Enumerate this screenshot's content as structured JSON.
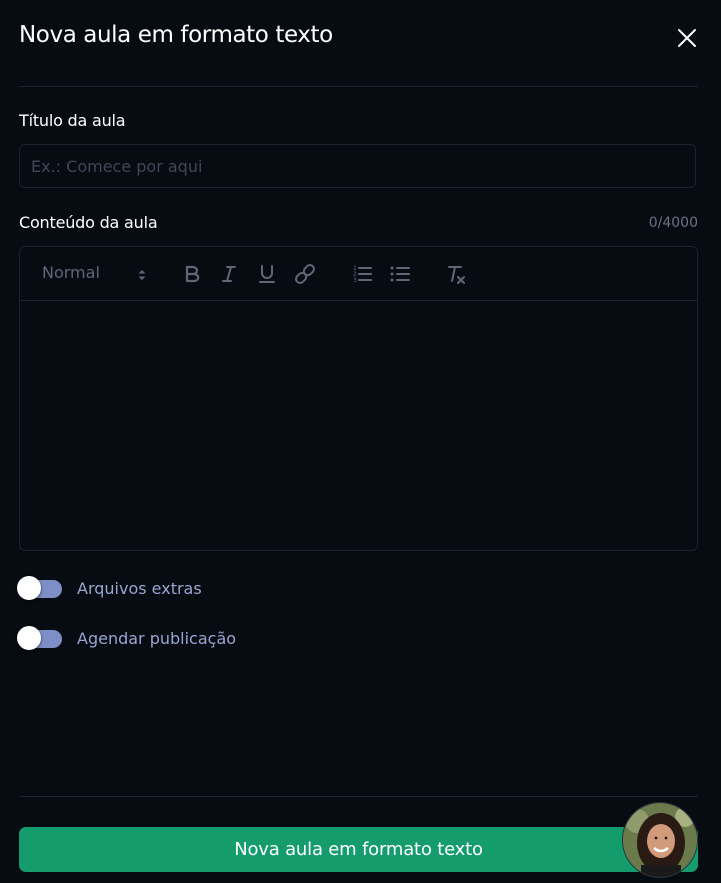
{
  "dialog": {
    "title": "Nova aula em formato texto"
  },
  "form": {
    "title_label": "Título da aula",
    "title_placeholder": "Ex.: Comece por aqui",
    "title_value": "",
    "content_label": "Conteúdo da aula",
    "content_counter": "0/4000",
    "content_value": ""
  },
  "editor_toolbar": {
    "format_select": "Normal",
    "tools": [
      "bold-icon",
      "italic-icon",
      "underline-icon",
      "link-icon",
      "ordered-list-icon",
      "bullet-list-icon",
      "clear-format-icon"
    ]
  },
  "toggles": [
    {
      "label": "Arquivos extras",
      "checked": false
    },
    {
      "label": "Agendar publicação",
      "checked": false
    }
  ],
  "footer": {
    "submit_label": "Nova aula em formato texto"
  },
  "colors": {
    "background": "#070b12",
    "accent": "#149c6d",
    "toggle_track": "#7d8fc6",
    "toggle_label": "#9aa6d0",
    "border": "#1b2130"
  }
}
